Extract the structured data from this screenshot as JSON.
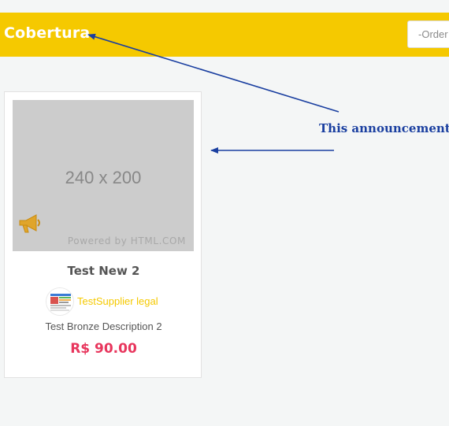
{
  "header": {
    "title": "Cobertura",
    "order_select_value": "-Order"
  },
  "card": {
    "image_size_label": "240 x 200",
    "image_powered_label": "Powered by HTML.COM",
    "title": "Test New 2",
    "supplier_name": "TestSupplier legal",
    "description": "Test Bronze Description 2",
    "price": "R$ 90.00"
  },
  "annotation": {
    "text": "This announcement is"
  },
  "colors": {
    "header_bg": "#f5c900",
    "accent": "#f5c900",
    "price": "#e8365d",
    "annotation": "#1a3fa0"
  }
}
